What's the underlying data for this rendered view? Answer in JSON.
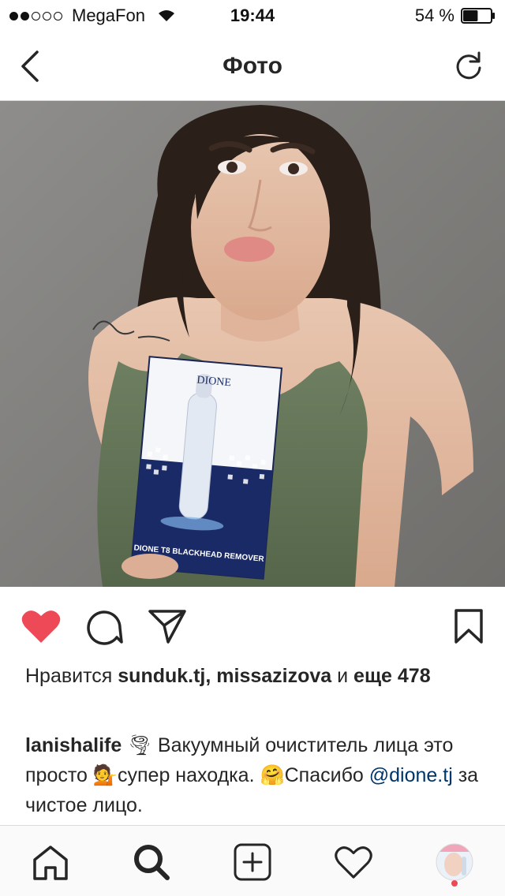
{
  "status_bar": {
    "carrier": "MegaFon",
    "signal_bars_filled": 2,
    "signal_bars_total": 5,
    "time": "19:44",
    "battery_percent": "54 %",
    "battery_level": 0.54
  },
  "nav": {
    "title": "Фото",
    "back_icon": "chevron-left-icon",
    "refresh_icon": "refresh-icon"
  },
  "post": {
    "product_box": {
      "brand": "DIONE",
      "product_name": "DIONE T8 BLACKHEAD REMOVER"
    },
    "actions": {
      "like_icon": "heart-filled-icon",
      "like_color": "#ed4956",
      "comment_icon": "comment-icon",
      "share_icon": "send-icon",
      "save_icon": "bookmark-icon"
    },
    "likes": {
      "prefix": "Нравится ",
      "users": "sunduk.tj, missazizova",
      "connector": " и ",
      "more": "еще 478"
    },
    "caption": {
      "username": "lanishalife",
      "emoji_1": "🌪",
      "text_1": " Вакуумный очиститель лица это просто ",
      "emoji_2": "💁",
      "text_2": "супер находка. ",
      "emoji_3": "🤗",
      "text_3": "Спасибо ",
      "mention": "@dione.tj",
      "text_4": " за чистое лицо."
    }
  },
  "tab_bar": {
    "items": [
      {
        "name": "home",
        "icon": "home-icon"
      },
      {
        "name": "search",
        "icon": "search-icon",
        "active": true
      },
      {
        "name": "new-post",
        "icon": "add-icon"
      },
      {
        "name": "activity",
        "icon": "heart-outline-icon"
      },
      {
        "name": "profile",
        "icon": "avatar"
      }
    ],
    "notification_color": "#ed4956"
  }
}
